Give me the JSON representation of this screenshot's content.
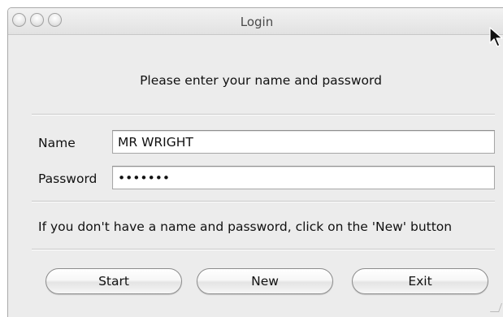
{
  "window": {
    "title": "Login"
  },
  "form": {
    "instruction": "Please enter your name and password",
    "name_label": "Name",
    "name_value": "MR WRIGHT",
    "password_label": "Password",
    "password_value": "•••••••",
    "info_text": "If you don't have a name and password, click on the 'New' button"
  },
  "buttons": {
    "start_label": "Start",
    "new_label": "New",
    "exit_label": "Exit"
  },
  "colors": {
    "window_background": "#ececec",
    "field_background": "#ffffff",
    "text": "#111111"
  }
}
